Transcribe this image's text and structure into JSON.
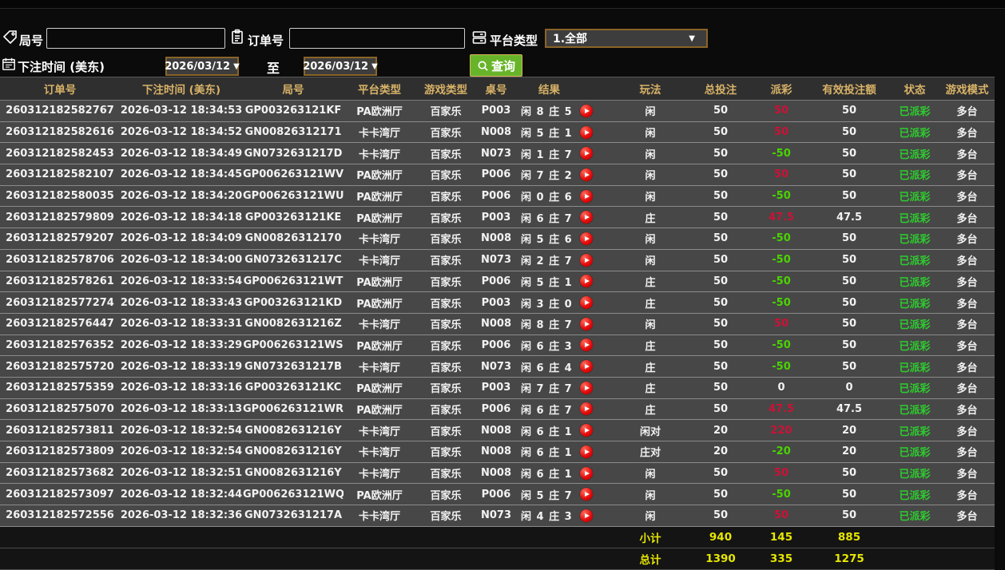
{
  "filters": {
    "round": {
      "label": "局号",
      "value": ""
    },
    "order": {
      "label": "订单号",
      "value": ""
    },
    "platform": {
      "label": "平台类型",
      "value": "1.全部"
    },
    "bet_time": {
      "label": "下注时间 (美东)"
    },
    "date_from": "2026/03/12",
    "date_to": "2026/03/12",
    "to_label": "至",
    "search_label": "查询",
    "dropdown_arrow": "▼"
  },
  "table": {
    "headers": [
      "订单号",
      "下注时间 (美东)",
      "局号",
      "平台类型",
      "游戏类型",
      "桌号",
      "结果",
      "玩法",
      "总投注",
      "派彩",
      "有效投注额",
      "状态",
      "游戏模式"
    ],
    "rows": [
      {
        "order": "260312182582767",
        "time": "2026-03-12 18:34:53",
        "round": "GP003263121KF",
        "platform": "PA欧洲厅",
        "game": "百家乐",
        "table": "P003",
        "result": "闲 8 庄 5",
        "play": "闲",
        "bet": "50",
        "payout": "50",
        "valid": "50",
        "status": "已派彩",
        "mode": "多台"
      },
      {
        "order": "260312182582616",
        "time": "2026-03-12 18:34:52",
        "round": "GN00826312171",
        "platform": "卡卡湾厅",
        "game": "百家乐",
        "table": "N008",
        "result": "闲 5 庄 1",
        "play": "闲",
        "bet": "50",
        "payout": "50",
        "valid": "50",
        "status": "已派彩",
        "mode": "多台"
      },
      {
        "order": "260312182582453",
        "time": "2026-03-12 18:34:49",
        "round": "GN0732631217D",
        "platform": "卡卡湾厅",
        "game": "百家乐",
        "table": "N073",
        "result": "闲 1 庄 7",
        "play": "闲",
        "bet": "50",
        "payout": "-50",
        "valid": "50",
        "status": "已派彩",
        "mode": "多台"
      },
      {
        "order": "260312182582107",
        "time": "2026-03-12 18:34:45",
        "round": "GP006263121WV",
        "platform": "PA欧洲厅",
        "game": "百家乐",
        "table": "P006",
        "result": "闲 7 庄 2",
        "play": "闲",
        "bet": "50",
        "payout": "50",
        "valid": "50",
        "status": "已派彩",
        "mode": "多台"
      },
      {
        "order": "260312182580035",
        "time": "2026-03-12 18:34:20",
        "round": "GP006263121WU",
        "platform": "PA欧洲厅",
        "game": "百家乐",
        "table": "P006",
        "result": "闲 0 庄 6",
        "play": "闲",
        "bet": "50",
        "payout": "-50",
        "valid": "50",
        "status": "已派彩",
        "mode": "多台"
      },
      {
        "order": "260312182579809",
        "time": "2026-03-12 18:34:18",
        "round": "GP003263121KE",
        "platform": "PA欧洲厅",
        "game": "百家乐",
        "table": "P003",
        "result": "闲 6 庄 7",
        "play": "庄",
        "bet": "50",
        "payout": "47.5",
        "valid": "47.5",
        "status": "已派彩",
        "mode": "多台"
      },
      {
        "order": "260312182579207",
        "time": "2026-03-12 18:34:09",
        "round": "GN00826312170",
        "platform": "卡卡湾厅",
        "game": "百家乐",
        "table": "N008",
        "result": "闲 5 庄 6",
        "play": "闲",
        "bet": "50",
        "payout": "-50",
        "valid": "50",
        "status": "已派彩",
        "mode": "多台"
      },
      {
        "order": "260312182578706",
        "time": "2026-03-12 18:34:00",
        "round": "GN0732631217C",
        "platform": "卡卡湾厅",
        "game": "百家乐",
        "table": "N073",
        "result": "闲 2 庄 7",
        "play": "闲",
        "bet": "50",
        "payout": "-50",
        "valid": "50",
        "status": "已派彩",
        "mode": "多台"
      },
      {
        "order": "260312182578261",
        "time": "2026-03-12 18:33:54",
        "round": "GP006263121WT",
        "platform": "PA欧洲厅",
        "game": "百家乐",
        "table": "P006",
        "result": "闲 5 庄 1",
        "play": "庄",
        "bet": "50",
        "payout": "-50",
        "valid": "50",
        "status": "已派彩",
        "mode": "多台"
      },
      {
        "order": "260312182577274",
        "time": "2026-03-12 18:33:43",
        "round": "GP003263121KD",
        "platform": "PA欧洲厅",
        "game": "百家乐",
        "table": "P003",
        "result": "闲 3 庄 0",
        "play": "庄",
        "bet": "50",
        "payout": "-50",
        "valid": "50",
        "status": "已派彩",
        "mode": "多台"
      },
      {
        "order": "260312182576447",
        "time": "2026-03-12 18:33:31",
        "round": "GN0082631216Z",
        "platform": "卡卡湾厅",
        "game": "百家乐",
        "table": "N008",
        "result": "闲 8 庄 7",
        "play": "闲",
        "bet": "50",
        "payout": "50",
        "valid": "50",
        "status": "已派彩",
        "mode": "多台"
      },
      {
        "order": "260312182576352",
        "time": "2026-03-12 18:33:29",
        "round": "GP006263121WS",
        "platform": "PA欧洲厅",
        "game": "百家乐",
        "table": "P006",
        "result": "闲 6 庄 3",
        "play": "庄",
        "bet": "50",
        "payout": "-50",
        "valid": "50",
        "status": "已派彩",
        "mode": "多台"
      },
      {
        "order": "260312182575720",
        "time": "2026-03-12 18:33:19",
        "round": "GN0732631217B",
        "platform": "卡卡湾厅",
        "game": "百家乐",
        "table": "N073",
        "result": "闲 6 庄 4",
        "play": "庄",
        "bet": "50",
        "payout": "-50",
        "valid": "50",
        "status": "已派彩",
        "mode": "多台"
      },
      {
        "order": "260312182575359",
        "time": "2026-03-12 18:33:16",
        "round": "GP003263121KC",
        "platform": "PA欧洲厅",
        "game": "百家乐",
        "table": "P003",
        "result": "闲 7 庄 7",
        "play": "庄",
        "bet": "50",
        "payout": "0",
        "valid": "0",
        "status": "已派彩",
        "mode": "多台"
      },
      {
        "order": "260312182575070",
        "time": "2026-03-12 18:33:13",
        "round": "GP006263121WR",
        "platform": "PA欧洲厅",
        "game": "百家乐",
        "table": "P006",
        "result": "闲 6 庄 7",
        "play": "庄",
        "bet": "50",
        "payout": "47.5",
        "valid": "47.5",
        "status": "已派彩",
        "mode": "多台"
      },
      {
        "order": "260312182573811",
        "time": "2026-03-12 18:32:54",
        "round": "GN0082631216Y",
        "platform": "卡卡湾厅",
        "game": "百家乐",
        "table": "N008",
        "result": "闲 6 庄 1",
        "play": "闲对",
        "bet": "20",
        "payout": "220",
        "valid": "20",
        "status": "已派彩",
        "mode": "多台"
      },
      {
        "order": "260312182573809",
        "time": "2026-03-12 18:32:54",
        "round": "GN0082631216Y",
        "platform": "卡卡湾厅",
        "game": "百家乐",
        "table": "N008",
        "result": "闲 6 庄 1",
        "play": "庄对",
        "bet": "20",
        "payout": "-20",
        "valid": "20",
        "status": "已派彩",
        "mode": "多台"
      },
      {
        "order": "260312182573682",
        "time": "2026-03-12 18:32:51",
        "round": "GN0082631216Y",
        "platform": "卡卡湾厅",
        "game": "百家乐",
        "table": "N008",
        "result": "闲 6 庄 1",
        "play": "闲",
        "bet": "50",
        "payout": "50",
        "valid": "50",
        "status": "已派彩",
        "mode": "多台"
      },
      {
        "order": "260312182573097",
        "time": "2026-03-12 18:32:44",
        "round": "GP006263121WQ",
        "platform": "PA欧洲厅",
        "game": "百家乐",
        "table": "P006",
        "result": "闲 5 庄 7",
        "play": "闲",
        "bet": "50",
        "payout": "-50",
        "valid": "50",
        "status": "已派彩",
        "mode": "多台"
      },
      {
        "order": "260312182572556",
        "time": "2026-03-12 18:32:36",
        "round": "GN0732631217A",
        "platform": "卡卡湾厅",
        "game": "百家乐",
        "table": "N073",
        "result": "闲 4 庄 3",
        "play": "闲",
        "bet": "50",
        "payout": "50",
        "valid": "50",
        "status": "已派彩",
        "mode": "多台"
      }
    ],
    "subtotal": {
      "label": "小计",
      "total_bet": "940",
      "payout": "145",
      "valid": "885"
    },
    "grand_total": {
      "label": "总计",
      "total_bet": "1390",
      "payout": "335",
      "valid": "1275"
    }
  },
  "colors": {
    "header_gold": "#d8b267",
    "payout_win_red": "#cb1236",
    "payout_lose_green": "#49d400",
    "status_green": "#2ecc2e",
    "summary_yellow": "#e6e600",
    "search_button_green": "#67b42a",
    "select_border_brown": "#8a6428"
  }
}
